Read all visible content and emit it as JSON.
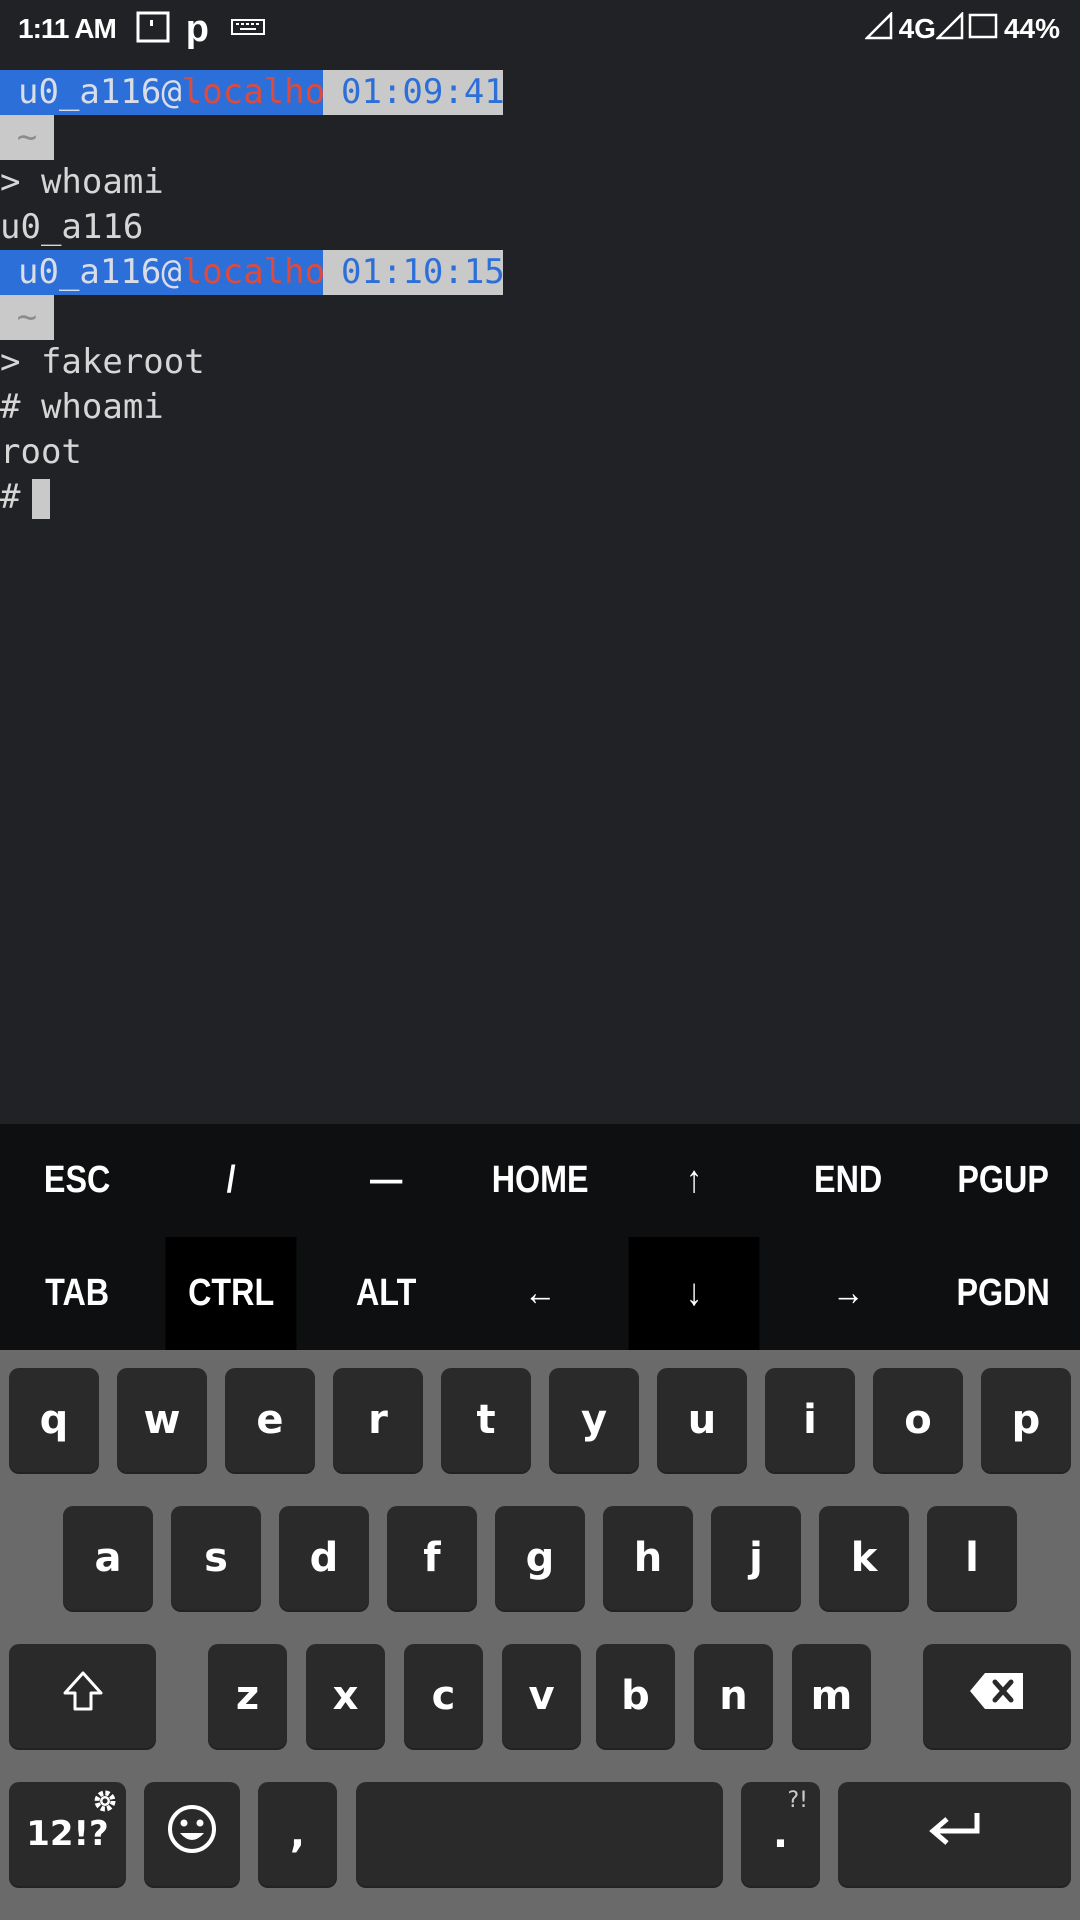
{
  "status_bar": {
    "time": "1:11 AM",
    "p_label": "p",
    "network": "4G",
    "battery": "44%"
  },
  "terminal": {
    "prompt1": {
      "user": "u0_a116",
      "at": "@",
      "host": "localhost",
      "time": "01:09:41"
    },
    "tilde": "~",
    "cmd1": "> whoami",
    "out1": "u0_a116",
    "prompt2": {
      "user": "u0_a116",
      "at": "@",
      "host": "localhost",
      "time": "01:10:15"
    },
    "cmd2": "> fakeroot",
    "cmd3": "# whoami",
    "out2": "root",
    "current_prompt": "#"
  },
  "extra_keys": {
    "row1": [
      "ESC",
      "/",
      "—",
      "HOME",
      "↑",
      "END",
      "PGUP"
    ],
    "row2": [
      "TAB",
      "CTRL",
      "ALT",
      "←",
      "↓",
      "→",
      "PGDN"
    ]
  },
  "keyboard": {
    "row1": [
      "q",
      "w",
      "e",
      "r",
      "t",
      "y",
      "u",
      "i",
      "o",
      "p"
    ],
    "row2": [
      "a",
      "s",
      "d",
      "f",
      "g",
      "h",
      "j",
      "k",
      "l"
    ],
    "row3": [
      "z",
      "x",
      "c",
      "v",
      "b",
      "n",
      "m"
    ],
    "symbols_label": "12!?",
    "comma_label": ",",
    "period_label": ".",
    "period_sub": "?!"
  }
}
